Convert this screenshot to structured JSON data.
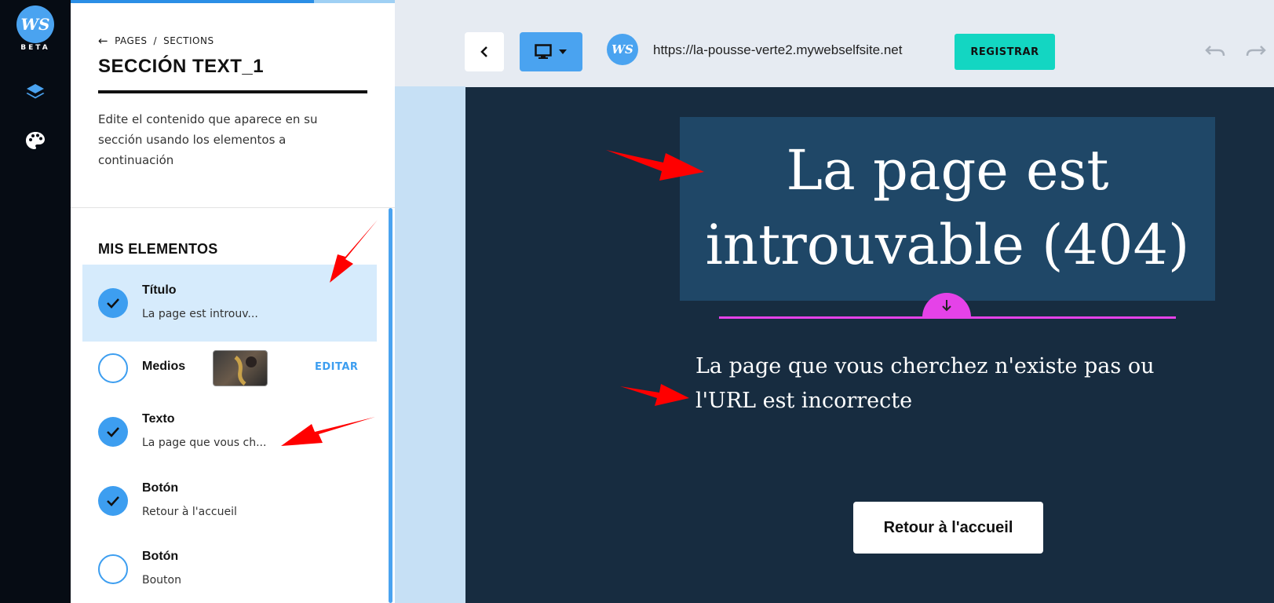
{
  "rail": {
    "logo": "WS",
    "beta": "BETA"
  },
  "breadcrumb": {
    "back_icon": "arrow-left-icon",
    "pages": "PAGES",
    "sep": "/",
    "sections": "SECTIONS"
  },
  "section": {
    "title": "SECCIÓN TEXT_1",
    "description": "Edite el contenido que aparece en su sección usando los elementos a continuación"
  },
  "elements": {
    "heading": "MIS ELEMENTOS",
    "items": [
      {
        "name": "Título",
        "sub": "La page est introuv...",
        "checked": true,
        "active": true
      },
      {
        "name": "Medios",
        "sub": "",
        "checked": false,
        "action": "EDITAR"
      },
      {
        "name": "Texto",
        "sub": "La page que vous ch...",
        "checked": true
      },
      {
        "name": "Botón",
        "sub": "Retour à l'accueil",
        "checked": true
      },
      {
        "name": "Botón",
        "sub": "Bouton",
        "checked": false
      }
    ]
  },
  "toolbar": {
    "back_icon": "chevron-left-icon",
    "device_icon": "desktop-icon",
    "logo": "WS",
    "url": "https://la-pousse-verte2.mywebselfsite.net",
    "register": "REGISTRAR",
    "undo_icon": "undo-icon",
    "redo_icon": "redo-icon"
  },
  "preview": {
    "title": "La page est introuvable (404)",
    "body": "La page que vous cherchez n'existe pas ou l'URL est incorrecte",
    "button": "Retour à l'accueil"
  },
  "colors": {
    "accent": "#4aa3f0",
    "register": "#13d6c2",
    "canvas": "#172c40",
    "title_box": "#1f4767",
    "divider_handle": "#e542e8",
    "arrow": "#ff0000"
  }
}
